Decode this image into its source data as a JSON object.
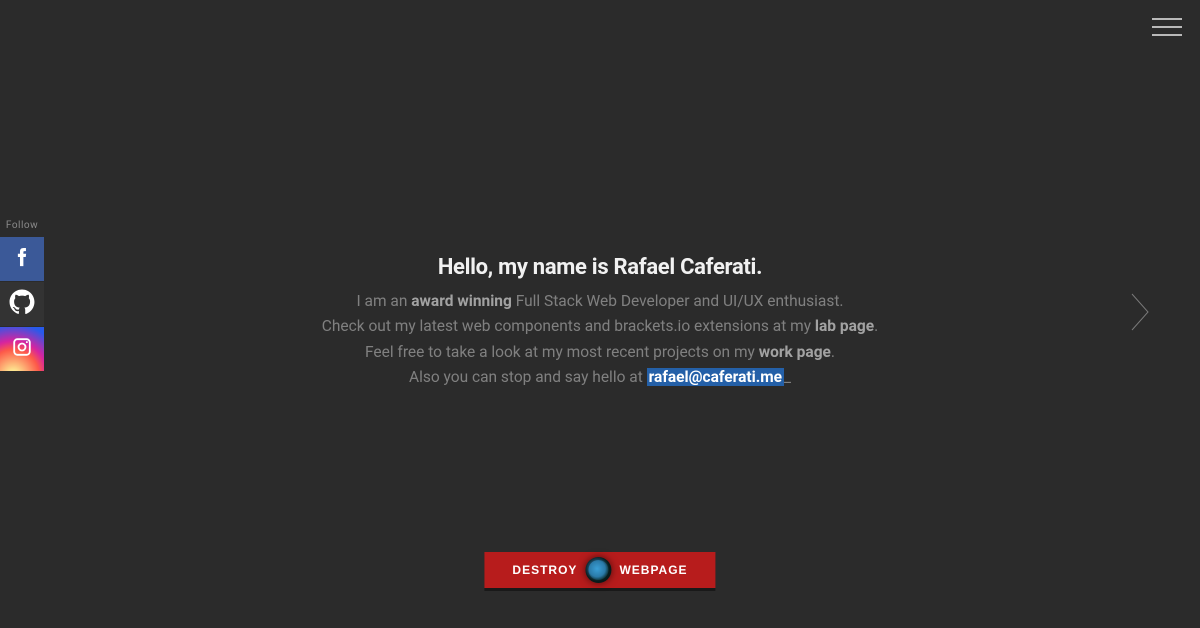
{
  "menu": {
    "name": "hamburger-menu"
  },
  "social": {
    "follow_label": "Follow",
    "facebook_name": "facebook-icon",
    "github_name": "github-icon",
    "instagram_name": "instagram-icon"
  },
  "hero": {
    "title": "Hello, my name is Rafael Caferati.",
    "line1_prefix": "I am an ",
    "line1_bold": "award winning",
    "line1_suffix": " Full Stack Web Developer and UI/UX enthusiast.",
    "line2_prefix": "Check out my latest web components and brackets.io extensions at my ",
    "line2_bold": "lab page",
    "line2_suffix": ".",
    "line3_prefix": "Feel free to take a look at my most recent projects on my ",
    "line3_bold": "work page",
    "line3_suffix": ".",
    "line4_prefix": "Also you can stop and say hello at ",
    "line4_email": "rafael@caferati.me",
    "line4_cursor": "_"
  },
  "nav": {
    "right_name": "next-slide"
  },
  "destroy": {
    "left_label": "DESTROY",
    "right_label": "WEBPAGE"
  }
}
